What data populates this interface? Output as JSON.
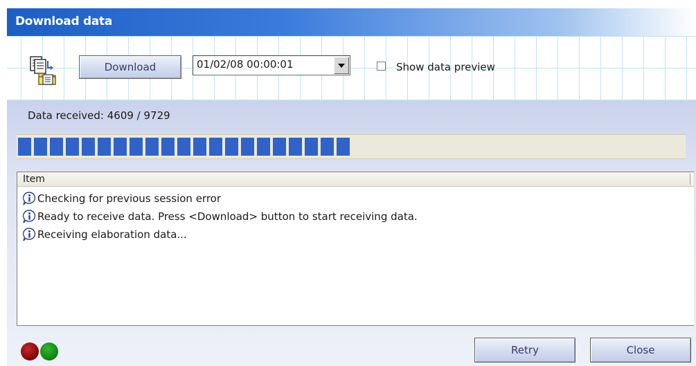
{
  "window": {
    "title": "Download data"
  },
  "toolbar": {
    "app_icon": "download-files-icon",
    "download_label": "Download",
    "date_value": "01/02/08 00:00:01",
    "show_preview_label": "Show data preview",
    "show_preview_checked": false
  },
  "progress": {
    "label": "Data received: 4609 / 9729",
    "received": 4609,
    "total": 9729,
    "fraction": 0.4737,
    "segments_filled": 21
  },
  "log": {
    "column_header": "Item",
    "entries": [
      {
        "icon": "info-icon",
        "text": "Checking for previous session error"
      },
      {
        "icon": "info-icon",
        "text": "Ready to receive data. Press <Download> button to start receiving data."
      },
      {
        "icon": "info-icon",
        "text": "Receiving elaboration data..."
      }
    ]
  },
  "status": {
    "red_light": "status-red-icon",
    "green_light": "status-green-icon"
  },
  "footer": {
    "retry_label": "Retry",
    "close_label": "Close"
  },
  "colors": {
    "title_bar": "#1c5ec4",
    "progress_fill": "#3162c8",
    "status_red": "#8b0a0a",
    "status_green": "#128a12"
  }
}
